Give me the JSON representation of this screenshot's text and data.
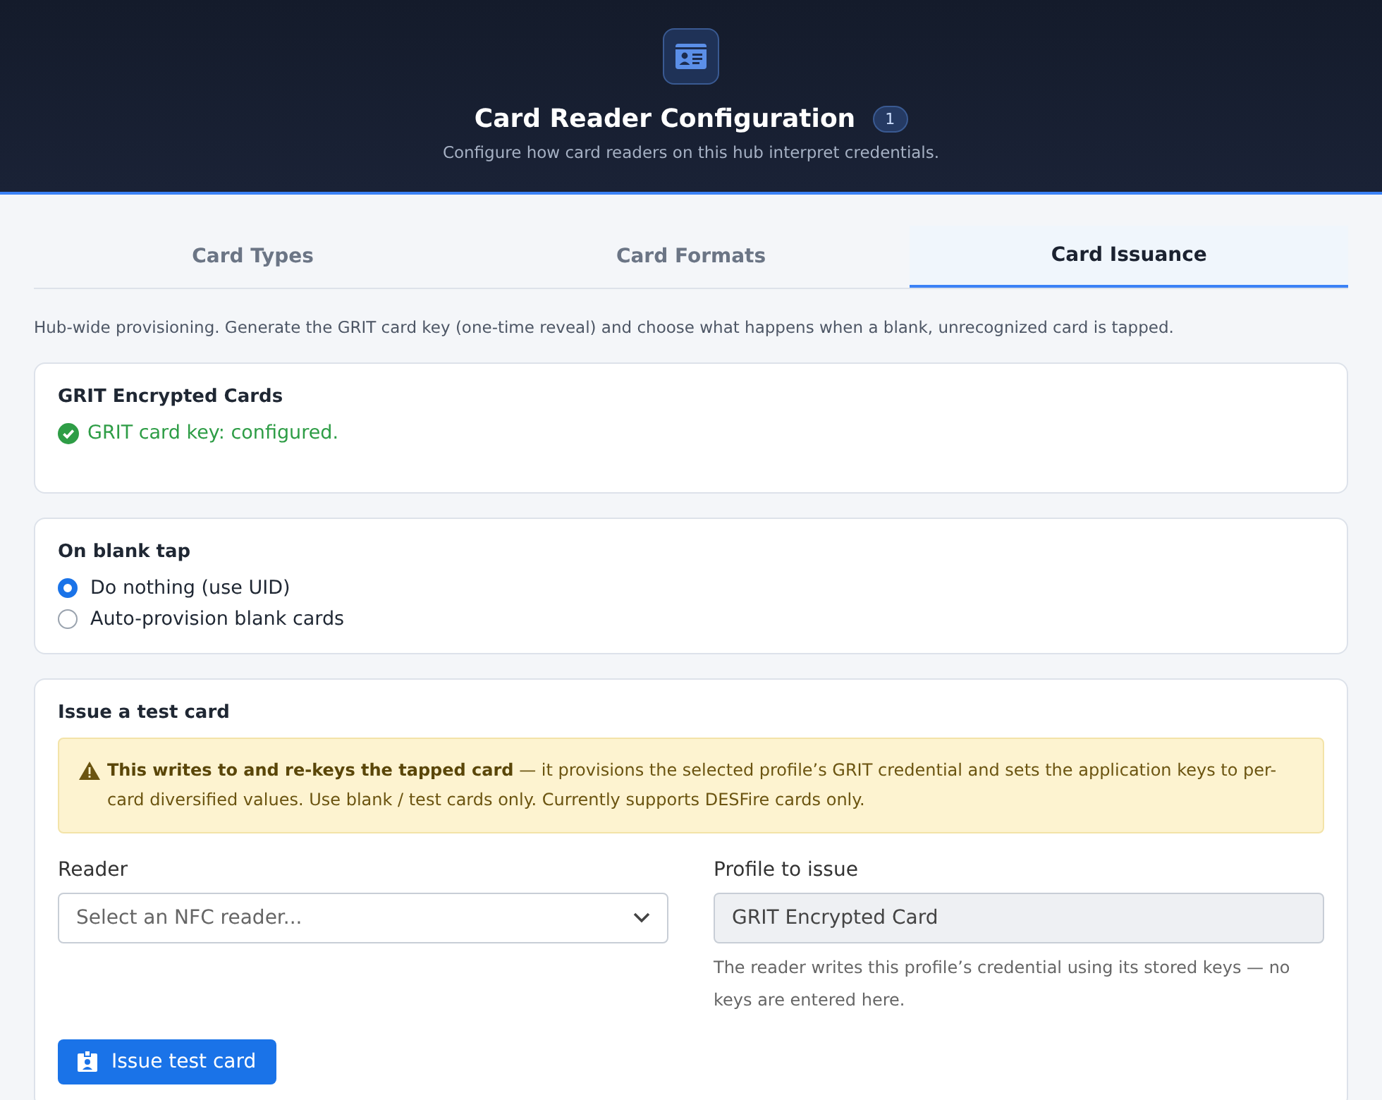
{
  "header": {
    "title": "Card Reader Configuration",
    "badge": "1",
    "subtitle": "Configure how card readers on this hub interpret credentials."
  },
  "tabs": [
    {
      "label": "Card Types",
      "selected": false
    },
    {
      "label": "Card Formats",
      "selected": false
    },
    {
      "label": "Card Issuance",
      "selected": true
    }
  ],
  "intro": "Hub-wide provisioning. Generate the GRIT card key (one-time reveal) and choose what happens when a blank, unrecognized card is tapped.",
  "grit_card": {
    "title": "GRIT Encrypted Cards",
    "status": {
      "text": "GRIT card key: configured.",
      "ok": true
    }
  },
  "blank_tap": {
    "title": "On blank tap",
    "options": [
      {
        "label": "Do nothing (use UID)",
        "selected": true
      },
      {
        "label": "Auto-provision blank cards",
        "selected": false
      }
    ]
  },
  "test_card": {
    "title": "Issue a test card",
    "warning": "**This writes to and re-keys the tapped card** — it provisions the selected profile’s GRIT credential and sets the application keys to per-card diversified values. Use blank / test cards only. Currently supports DESFire cards only.",
    "reader": {
      "label": "Reader",
      "placeholder": "Select an NFC reader..."
    },
    "profile": {
      "label": "Profile to issue",
      "value": "GRIT Encrypted Card",
      "disabled": true,
      "help": "The reader writes this profile’s credential using its stored keys — no keys are entered here."
    },
    "button": "Issue test card"
  }
}
